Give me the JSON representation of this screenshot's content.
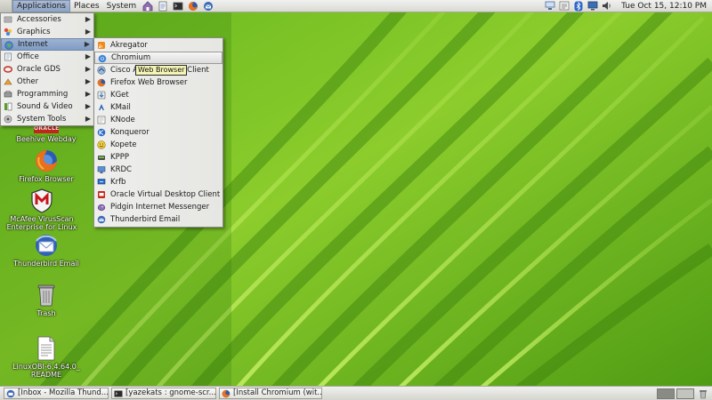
{
  "top_panel": {
    "menus": [
      {
        "label": "Applications",
        "active": true
      },
      {
        "label": "Places",
        "active": false
      },
      {
        "label": "System",
        "active": false
      }
    ],
    "launchers": [
      "home-folder-icon",
      "text-editor-icon",
      "firefox-icon",
      "thunderbird-icon",
      "terminal-icon"
    ],
    "tray_icons": [
      "network-icon",
      "update-icon",
      "bluetooth-icon",
      "display-icon",
      "volume-icon"
    ],
    "clock": "Tue Oct 15, 12:10 PM"
  },
  "applications_menu": {
    "items": [
      {
        "label": "Accessories",
        "icon": "accessories-icon",
        "has_submenu": true
      },
      {
        "label": "Graphics",
        "icon": "graphics-icon",
        "has_submenu": true
      },
      {
        "label": "Internet",
        "icon": "internet-globe-icon",
        "has_submenu": true,
        "open": true
      },
      {
        "label": "Office",
        "icon": "office-icon",
        "has_submenu": true
      },
      {
        "label": "Oracle GDS",
        "icon": "oracle-icon",
        "has_submenu": true
      },
      {
        "label": "Other",
        "icon": "other-icon",
        "has_submenu": true
      },
      {
        "label": "Programming",
        "icon": "programming-icon",
        "has_submenu": true
      },
      {
        "label": "Sound & Video",
        "icon": "sound-video-icon",
        "has_submenu": true
      },
      {
        "label": "System Tools",
        "icon": "system-tools-icon",
        "has_submenu": true
      }
    ]
  },
  "internet_submenu": {
    "items": [
      {
        "label": "Akregator",
        "icon": "akregator-icon"
      },
      {
        "label": "Chromium",
        "icon": "chromium-icon",
        "hovered": true
      },
      {
        "label": "Cisco AnyConnect VPN Client",
        "visible_label_left": "Cisco A",
        "visible_label_right": "N Client",
        "icon": "cisco-icon"
      },
      {
        "label": "Firefox Web Browser",
        "icon": "firefox-icon"
      },
      {
        "label": "KGet",
        "icon": "kget-icon"
      },
      {
        "label": "KMail",
        "icon": "kmail-icon"
      },
      {
        "label": "KNode",
        "icon": "knode-icon"
      },
      {
        "label": "Konqueror",
        "icon": "konqueror-icon"
      },
      {
        "label": "Kopete",
        "icon": "kopete-icon"
      },
      {
        "label": "KPPP",
        "icon": "kppp-icon"
      },
      {
        "label": "KRDC",
        "icon": "krdc-icon"
      },
      {
        "label": "Krfb",
        "icon": "krfb-icon"
      },
      {
        "label": "Oracle Virtual Desktop Client",
        "icon": "oracle-vdc-icon"
      },
      {
        "label": "Pidgin Internet Messenger",
        "icon": "pidgin-icon"
      },
      {
        "label": "Thunderbird Email",
        "icon": "thunderbird-icon"
      }
    ],
    "tooltip": "Web Browser"
  },
  "desktop_icons": [
    {
      "label_lines": [
        "Beehive Webday"
      ],
      "icon": "oracle-beehive-icon",
      "badge": "ORACLE"
    },
    {
      "label_lines": [
        "Firefox  Browser"
      ],
      "icon": "firefox-icon"
    },
    {
      "label_lines": [
        "McAfee VirusScan",
        "Enterprise for Linux"
      ],
      "icon": "mcafee-shield-icon"
    },
    {
      "label_lines": [
        "Thunderbird Email"
      ],
      "icon": "thunderbird-icon"
    },
    {
      "label_lines": [
        "Trash"
      ],
      "icon": "trash-icon"
    },
    {
      "label_lines": [
        "LinuxOBI-6.4.64.0_",
        "README"
      ],
      "icon": "text-file-icon"
    }
  ],
  "taskbar": {
    "tasks": [
      {
        "label": "[Inbox - Mozilla Thund...",
        "icon": "thunderbird-icon"
      },
      {
        "label": "[yazekats : gnome-scr...",
        "icon": "terminal-icon"
      },
      {
        "label": "[Install Chromium (wit...",
        "icon": "firefox-icon"
      }
    ],
    "workspaces": 2,
    "active_workspace": 1
  },
  "colors": {
    "wallpaper_dark": "#3e8a10",
    "wallpaper_light": "#a9e23a",
    "menu_highlight": "#8ea5c6"
  }
}
